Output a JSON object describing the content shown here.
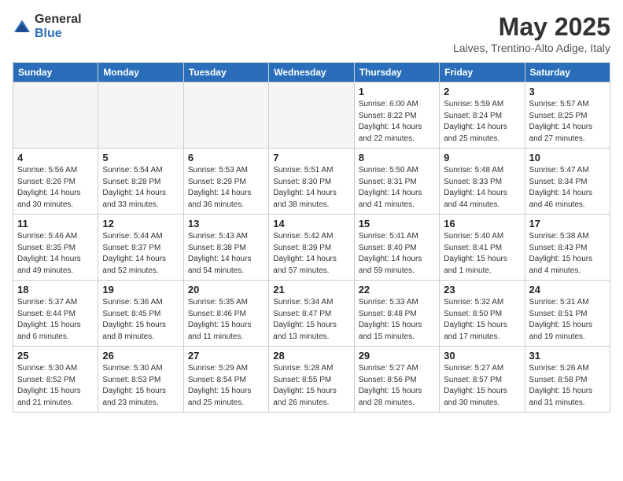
{
  "logo": {
    "text_general": "General",
    "text_blue": "Blue"
  },
  "title": "May 2025",
  "subtitle": "Laives, Trentino-Alto Adige, Italy",
  "weekdays": [
    "Sunday",
    "Monday",
    "Tuesday",
    "Wednesday",
    "Thursday",
    "Friday",
    "Saturday"
  ],
  "weeks": [
    [
      {
        "day": "",
        "info": "",
        "empty": true
      },
      {
        "day": "",
        "info": "",
        "empty": true
      },
      {
        "day": "",
        "info": "",
        "empty": true
      },
      {
        "day": "",
        "info": "",
        "empty": true
      },
      {
        "day": "1",
        "info": "Sunrise: 6:00 AM\nSunset: 8:22 PM\nDaylight: 14 hours\nand 22 minutes."
      },
      {
        "day": "2",
        "info": "Sunrise: 5:59 AM\nSunset: 8:24 PM\nDaylight: 14 hours\nand 25 minutes."
      },
      {
        "day": "3",
        "info": "Sunrise: 5:57 AM\nSunset: 8:25 PM\nDaylight: 14 hours\nand 27 minutes."
      }
    ],
    [
      {
        "day": "4",
        "info": "Sunrise: 5:56 AM\nSunset: 8:26 PM\nDaylight: 14 hours\nand 30 minutes."
      },
      {
        "day": "5",
        "info": "Sunrise: 5:54 AM\nSunset: 8:28 PM\nDaylight: 14 hours\nand 33 minutes."
      },
      {
        "day": "6",
        "info": "Sunrise: 5:53 AM\nSunset: 8:29 PM\nDaylight: 14 hours\nand 36 minutes."
      },
      {
        "day": "7",
        "info": "Sunrise: 5:51 AM\nSunset: 8:30 PM\nDaylight: 14 hours\nand 38 minutes."
      },
      {
        "day": "8",
        "info": "Sunrise: 5:50 AM\nSunset: 8:31 PM\nDaylight: 14 hours\nand 41 minutes."
      },
      {
        "day": "9",
        "info": "Sunrise: 5:48 AM\nSunset: 8:33 PM\nDaylight: 14 hours\nand 44 minutes."
      },
      {
        "day": "10",
        "info": "Sunrise: 5:47 AM\nSunset: 8:34 PM\nDaylight: 14 hours\nand 46 minutes."
      }
    ],
    [
      {
        "day": "11",
        "info": "Sunrise: 5:46 AM\nSunset: 8:35 PM\nDaylight: 14 hours\nand 49 minutes."
      },
      {
        "day": "12",
        "info": "Sunrise: 5:44 AM\nSunset: 8:37 PM\nDaylight: 14 hours\nand 52 minutes."
      },
      {
        "day": "13",
        "info": "Sunrise: 5:43 AM\nSunset: 8:38 PM\nDaylight: 14 hours\nand 54 minutes."
      },
      {
        "day": "14",
        "info": "Sunrise: 5:42 AM\nSunset: 8:39 PM\nDaylight: 14 hours\nand 57 minutes."
      },
      {
        "day": "15",
        "info": "Sunrise: 5:41 AM\nSunset: 8:40 PM\nDaylight: 14 hours\nand 59 minutes."
      },
      {
        "day": "16",
        "info": "Sunrise: 5:40 AM\nSunset: 8:41 PM\nDaylight: 15 hours\nand 1 minute."
      },
      {
        "day": "17",
        "info": "Sunrise: 5:38 AM\nSunset: 8:43 PM\nDaylight: 15 hours\nand 4 minutes."
      }
    ],
    [
      {
        "day": "18",
        "info": "Sunrise: 5:37 AM\nSunset: 8:44 PM\nDaylight: 15 hours\nand 6 minutes."
      },
      {
        "day": "19",
        "info": "Sunrise: 5:36 AM\nSunset: 8:45 PM\nDaylight: 15 hours\nand 8 minutes."
      },
      {
        "day": "20",
        "info": "Sunrise: 5:35 AM\nSunset: 8:46 PM\nDaylight: 15 hours\nand 11 minutes."
      },
      {
        "day": "21",
        "info": "Sunrise: 5:34 AM\nSunset: 8:47 PM\nDaylight: 15 hours\nand 13 minutes."
      },
      {
        "day": "22",
        "info": "Sunrise: 5:33 AM\nSunset: 8:48 PM\nDaylight: 15 hours\nand 15 minutes."
      },
      {
        "day": "23",
        "info": "Sunrise: 5:32 AM\nSunset: 8:50 PM\nDaylight: 15 hours\nand 17 minutes."
      },
      {
        "day": "24",
        "info": "Sunrise: 5:31 AM\nSunset: 8:51 PM\nDaylight: 15 hours\nand 19 minutes."
      }
    ],
    [
      {
        "day": "25",
        "info": "Sunrise: 5:30 AM\nSunset: 8:52 PM\nDaylight: 15 hours\nand 21 minutes."
      },
      {
        "day": "26",
        "info": "Sunrise: 5:30 AM\nSunset: 8:53 PM\nDaylight: 15 hours\nand 23 minutes."
      },
      {
        "day": "27",
        "info": "Sunrise: 5:29 AM\nSunset: 8:54 PM\nDaylight: 15 hours\nand 25 minutes."
      },
      {
        "day": "28",
        "info": "Sunrise: 5:28 AM\nSunset: 8:55 PM\nDaylight: 15 hours\nand 26 minutes."
      },
      {
        "day": "29",
        "info": "Sunrise: 5:27 AM\nSunset: 8:56 PM\nDaylight: 15 hours\nand 28 minutes."
      },
      {
        "day": "30",
        "info": "Sunrise: 5:27 AM\nSunset: 8:57 PM\nDaylight: 15 hours\nand 30 minutes."
      },
      {
        "day": "31",
        "info": "Sunrise: 5:26 AM\nSunset: 8:58 PM\nDaylight: 15 hours\nand 31 minutes."
      }
    ]
  ]
}
